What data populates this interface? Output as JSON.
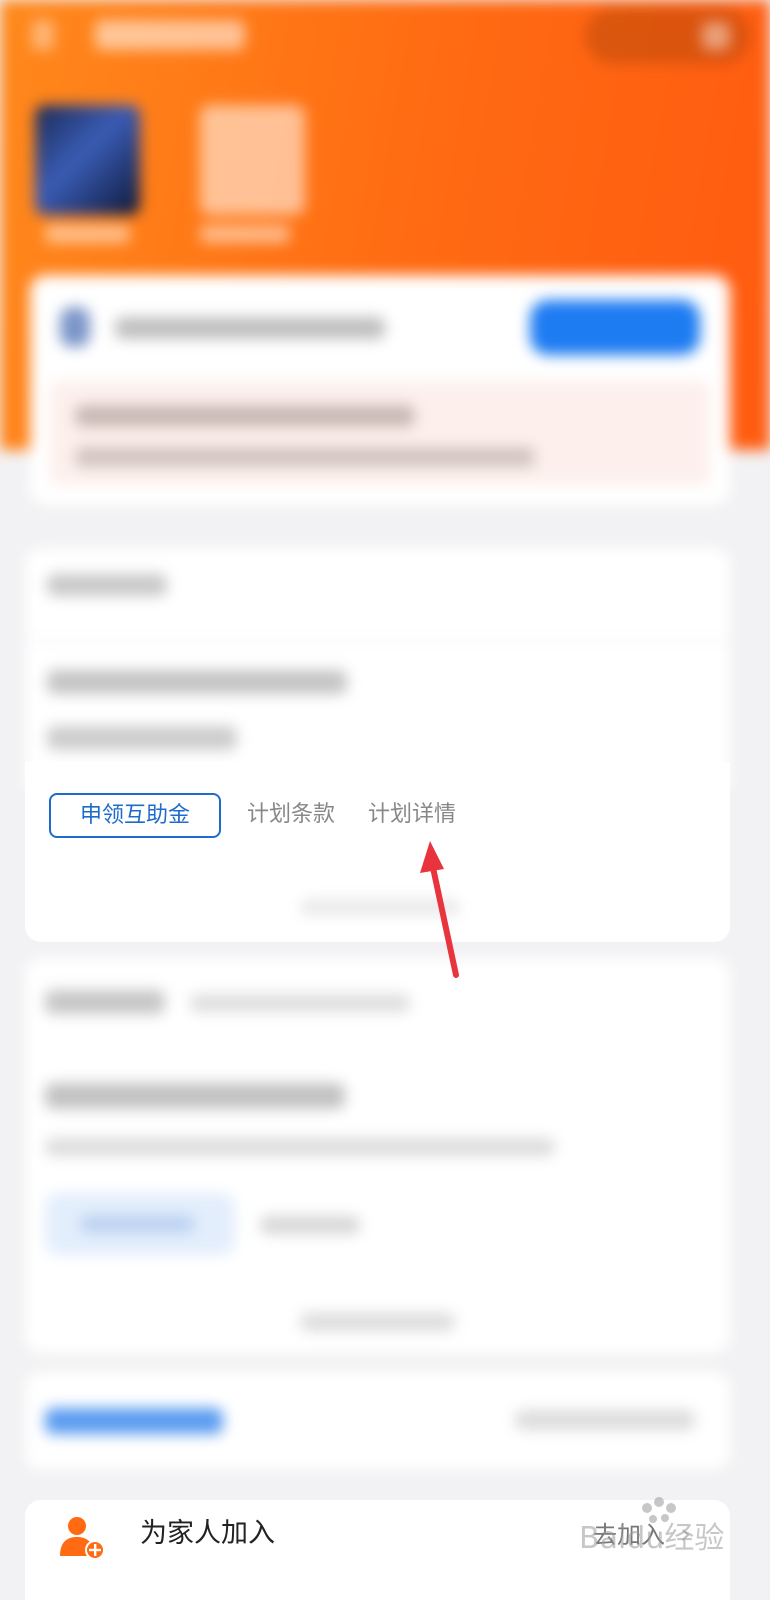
{
  "tabs": {
    "apply_label": "申领互助金",
    "terms_label": "计划条款",
    "detail_label": "计划详情"
  },
  "family": {
    "label": "为家人加入",
    "action_label": "去加入",
    "chevron": "›"
  },
  "watermark": {
    "text": "Baidu经验"
  },
  "colors": {
    "brand_orange": "#ff6a12",
    "tab_blue": "#1e6bcc",
    "arrow_red": "#e8343c",
    "page_bg": "#f2f2f4"
  },
  "icons": {
    "family_icon": "person-add-icon",
    "annotation": "red-arrow-icon"
  }
}
